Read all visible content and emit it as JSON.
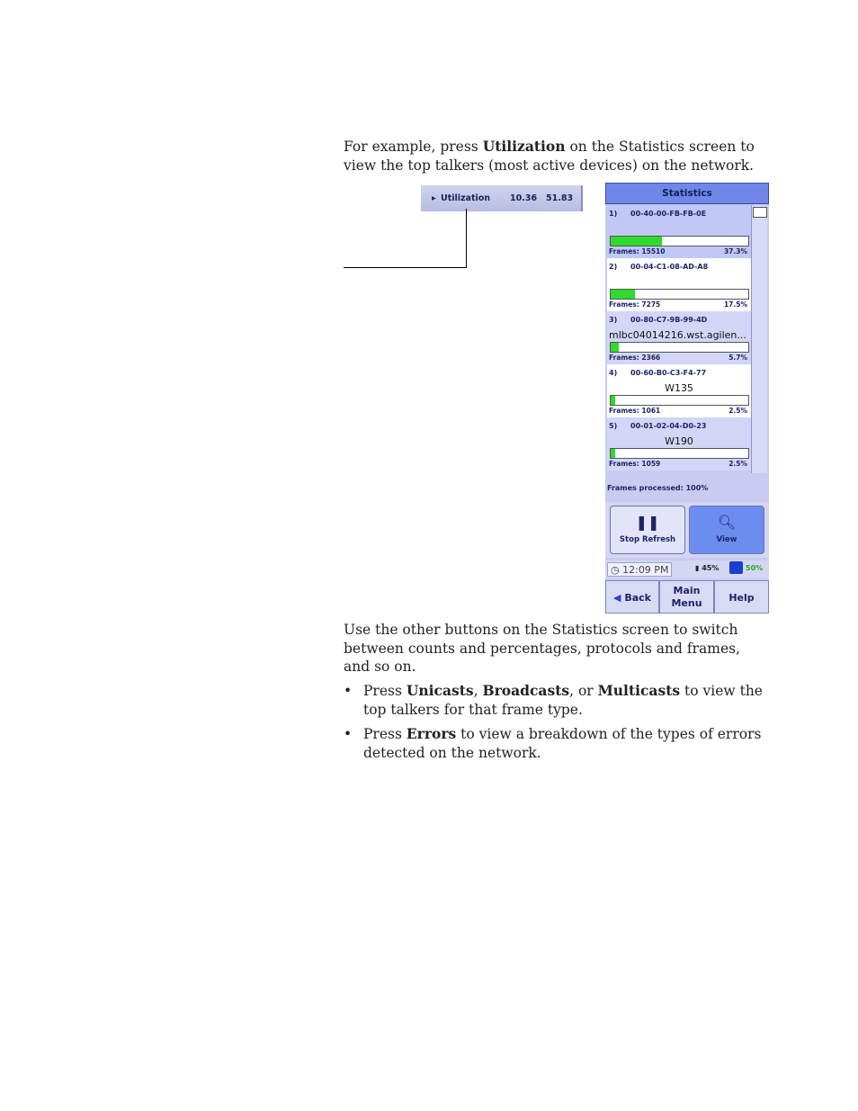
{
  "intro": {
    "part1": "For example, press ",
    "bold": "Utilization",
    "part2": " on the Statistics screen to view the top talkers (most active devices) on the network."
  },
  "callout": {
    "label": "Utilization",
    "val1": "10.36",
    "val2": "51.83"
  },
  "screen": {
    "title": "Statistics",
    "entries": [
      {
        "num": "1)",
        "mac": "00-40-00-FB-FB-0E",
        "host": "",
        "frames": "Frames: 15510",
        "pct": "37.3%",
        "fill": 0.373
      },
      {
        "num": "2)",
        "mac": "00-04-C1-08-AD-A8",
        "host": "",
        "frames": "Frames: 7275",
        "pct": "17.5%",
        "fill": 0.175
      },
      {
        "num": "3)",
        "mac": "00-80-C7-9B-99-4D",
        "host": "mlbc04014216.wst.agilen...",
        "frames": "Frames: 2366",
        "pct": "5.7%",
        "fill": 0.057
      },
      {
        "num": "4)",
        "mac": "00-60-B0-C3-F4-77",
        "host": "W135",
        "frames": "Frames: 1061",
        "pct": "2.5%",
        "fill": 0.025
      },
      {
        "num": "5)",
        "mac": "00-01-02-04-D0-23",
        "host": "W190",
        "frames": "Frames: 1059",
        "pct": "2.5%",
        "fill": 0.025
      }
    ],
    "processed": "Frames processed: 100%",
    "stop_label": "Stop Refresh",
    "view_label": "View",
    "time": "12:09 PM",
    "battery": "45%",
    "disk": "50%",
    "back": "Back",
    "main_menu_1": "Main",
    "main_menu_2": "Menu",
    "help": "Help"
  },
  "para2": "Use the other buttons on the Statistics screen to switch between counts and percentages, protocols and frames, and so on.",
  "bullets": {
    "b1_press": "Press ",
    "b1_unicasts": "Unicasts",
    "b1_comma": ", ",
    "b1_broadcasts": "Broadcasts",
    "b1_or": ", or ",
    "b1_multicasts": "Multicasts",
    "b1_rest": " to view the top talkers for that frame type.",
    "b2_press": "Press ",
    "b2_errors": "Errors",
    "b2_rest": " to view a breakdown of the types of errors detected on the network."
  }
}
